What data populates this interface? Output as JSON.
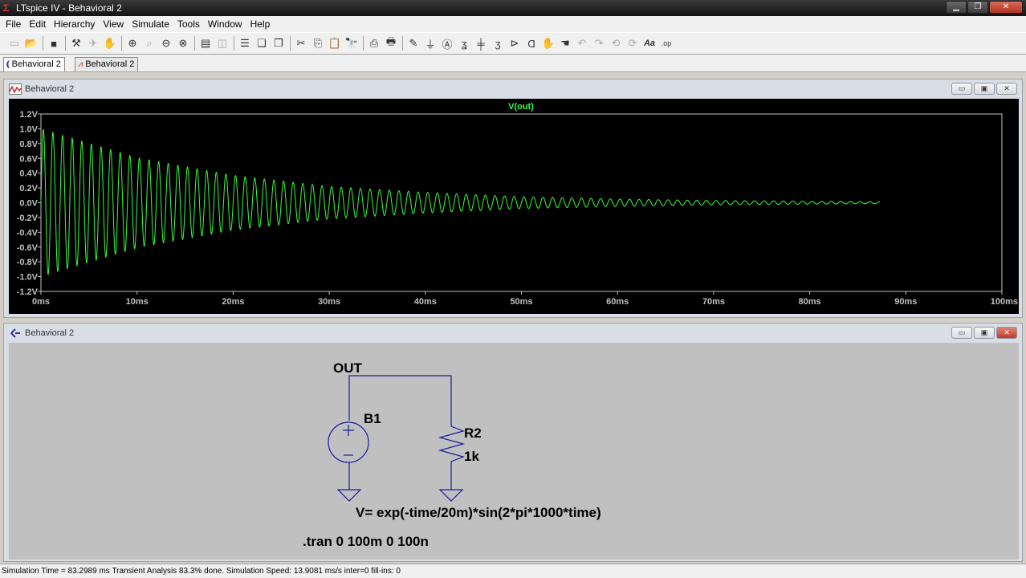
{
  "window": {
    "title": "LTspice IV - Behavioral 2"
  },
  "menu": [
    "File",
    "Edit",
    "Hierarchy",
    "View",
    "Simulate",
    "Tools",
    "Window",
    "Help"
  ],
  "toolbar_icons": [
    "new-schematic-icon",
    "open-icon",
    "save-icon",
    "control-panel-icon",
    "run-icon",
    "halt-icon",
    "zoom-in-icon",
    "pan-icon",
    "zoom-out-icon",
    "zoom-fit-icon",
    "autorange-icon",
    "tile-horizontal-icon",
    "tile-vertical-icon",
    "cascade-icon",
    "cut-icon",
    "copy-icon",
    "paste-icon",
    "find-icon",
    "print-setup-icon",
    "print-icon",
    "wire-icon",
    "ground-icon",
    "label-net-icon",
    "resistor-icon",
    "capacitor-icon",
    "inductor-icon",
    "diode-icon",
    "component-icon",
    "move-icon",
    "drag-icon",
    "undo-icon",
    "redo-icon",
    "rotate-icon",
    "mirror-icon",
    "text-icon",
    "spice-directive-icon"
  ],
  "tabs": [
    {
      "label": "Behavioral 2",
      "kind": "schematic"
    },
    {
      "label": "Behavioral 2",
      "kind": "waveform"
    }
  ],
  "waveform_window": {
    "title": "Behavioral 2"
  },
  "schematic_window": {
    "title": "Behavioral 2"
  },
  "colors": {
    "trace": "#33ff33",
    "plot_bg": "#000000",
    "axis": "#c0c0c0",
    "wire": "#1a1aa0",
    "schematic_bg": "#c0c0c0"
  },
  "chart_data": {
    "type": "line",
    "title": "V(out)",
    "xlabel": "",
    "ylabel": "",
    "xlim": [
      0,
      100
    ],
    "ylim": [
      -1.2,
      1.2
    ],
    "x_ticks": [
      "0ms",
      "10ms",
      "20ms",
      "30ms",
      "40ms",
      "50ms",
      "60ms",
      "70ms",
      "80ms",
      "90ms",
      "100ms"
    ],
    "y_ticks": [
      "1.2V",
      "1.0V",
      "0.8V",
      "0.6V",
      "0.4V",
      "0.2V",
      "0.0V",
      "-0.2V",
      "-0.4V",
      "-0.6V",
      "-0.8V",
      "-1.0V",
      "-1.2V"
    ],
    "grid": false,
    "series": [
      {
        "name": "V(out)",
        "x_unit": "ms",
        "y_unit": "V",
        "x": [
          0,
          10,
          20,
          30,
          40,
          50,
          60,
          70,
          80,
          87.3
        ],
        "envelope": [
          1.0,
          0.61,
          0.37,
          0.22,
          0.14,
          0.08,
          0.05,
          0.03,
          0.02,
          0.013
        ],
        "frequency_cycles_per_ms": 1,
        "simulated_until_ms": 87.3
      }
    ]
  },
  "schematic": {
    "net_label": "OUT",
    "source": {
      "name": "B1",
      "expression": "V= exp(-time/20m)*sin(2*pi*1000*time)"
    },
    "resistor": {
      "name": "R2",
      "value": "1k"
    },
    "directive": ".tran 0 100m 0 100n"
  },
  "status": "Simulation Time = 83.2989 ms  Transient Analysis 83.3% done. Simulation Speed: 13.9081 ms/s inter=0 fill-ins: 0"
}
